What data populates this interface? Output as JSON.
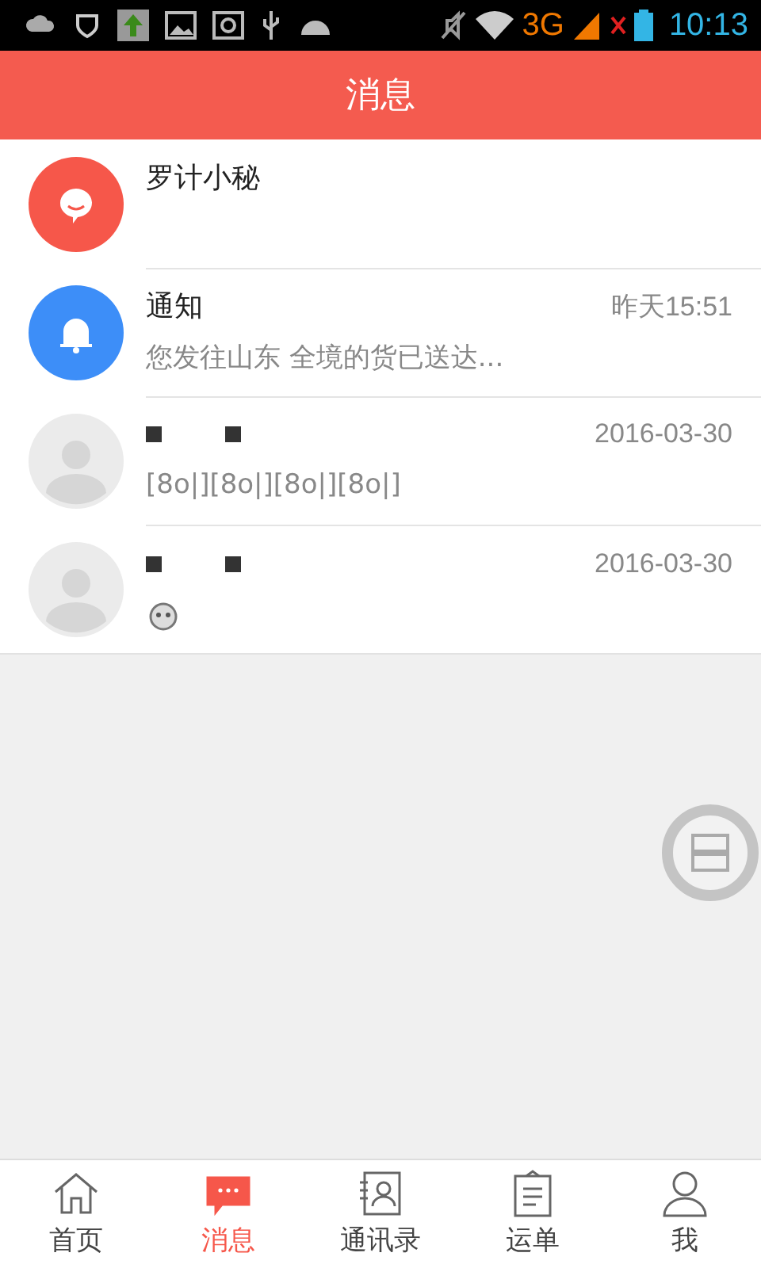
{
  "status_bar": {
    "network": "3G",
    "time": "10:13"
  },
  "header": {
    "title": "消息"
  },
  "conversations": [
    {
      "kind": "assistant",
      "name": "罗计小秘",
      "redacted": false
    },
    {
      "kind": "notice",
      "name": "通知",
      "redacted": false,
      "time": "昨天15:51",
      "preview": {
        "kind": "text",
        "text": "您发往山东 全境的货已送达..."
      }
    },
    {
      "kind": "contact",
      "redacted": true,
      "time": "2016-03-30",
      "preview": {
        "kind": "text",
        "text": "[8o|][8o|][8o|][8o|]"
      }
    },
    {
      "kind": "contact",
      "redacted": true,
      "time": "2016-03-30",
      "preview": {
        "kind": "emoji"
      }
    }
  ],
  "nav": [
    {
      "label": "首页",
      "selected": false
    },
    {
      "label": "消息",
      "selected": true
    },
    {
      "label": "通讯录",
      "selected": false
    },
    {
      "label": "运单",
      "selected": false
    },
    {
      "label": "我",
      "selected": false
    }
  ]
}
